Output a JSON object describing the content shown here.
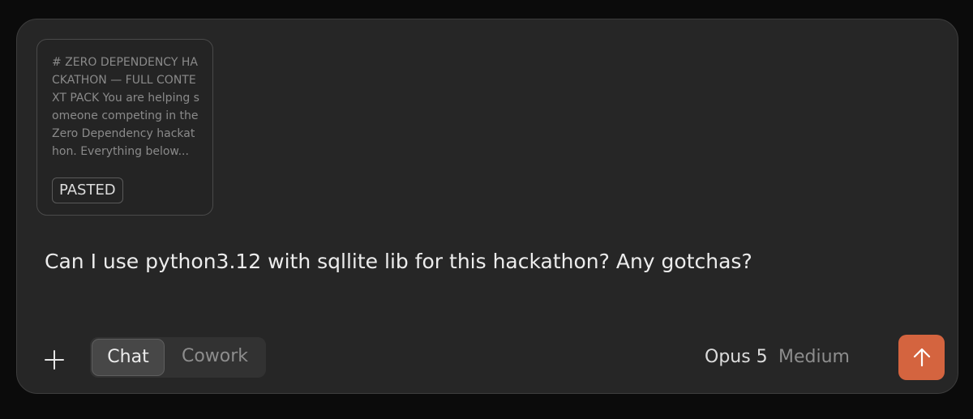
{
  "attachment": {
    "preview_text": "# ZERO DEPENDENCY HACKATHON — FULL CONTEXT PACK You are helping someone competing in the Zero Dependency hackathon. Everything below...",
    "badge_label": "PASTED"
  },
  "prompt": {
    "text": "Can I use python3.12 with sqllite lib for this hackathon? Any gotchas?"
  },
  "toolbar": {
    "add_icon": "plus-icon",
    "modes": [
      "Chat",
      "Cowork"
    ],
    "selected_mode": "Chat",
    "model": "Opus 5",
    "effort": "Medium",
    "send_icon": "arrow-up-icon"
  },
  "colors": {
    "accent": "#d4643f",
    "panel": "#262626",
    "background": "#0b0b0b"
  }
}
